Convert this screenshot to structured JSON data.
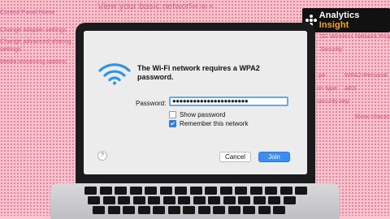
{
  "background": {
    "title": "View your basic networ",
    "title2": "Set up a...",
    "left_links": [
      "Control Panel Home",
      "Change adapter settings",
      "Change advanced sharing",
      "settings",
      "Media streaming options"
    ],
    "right_texts": [
      "5G Wireless Network Propo",
      "Security",
      "WPA2-Personal",
      "AES",
      "Show characters"
    ],
    "right_labels": [
      "pe:",
      "on type:",
      "security key"
    ]
  },
  "brand": {
    "name_prefix": "Analytics ",
    "name_highlight": "Insight"
  },
  "dialog": {
    "message": "The Wi-Fi network requires a WPA2 password.",
    "password_label": "Password:",
    "password_value": "●●●●●●●●●●●●●●●●●●●●●●",
    "show_password_label": "Show password",
    "show_password_checked": false,
    "remember_label": "Remember this network",
    "remember_checked": true,
    "help_label": "?",
    "cancel_label": "Cancel",
    "join_label": "Join"
  },
  "colors": {
    "accent": "#3b8df0",
    "wifi": "#2f93e8",
    "background": "#f6c3cc"
  },
  "icons": {
    "wifi": "wifi-icon",
    "help": "help-icon",
    "brand": "analytics-insight-logo-icon"
  }
}
